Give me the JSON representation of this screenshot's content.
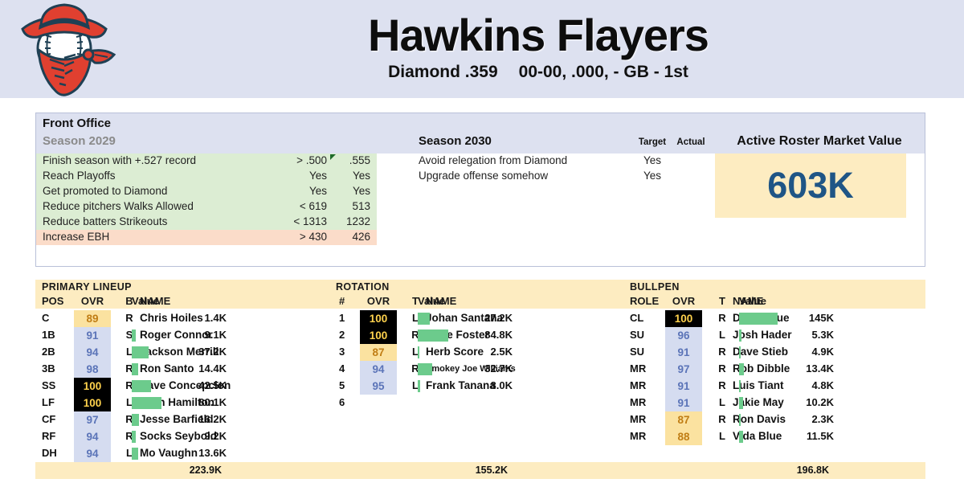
{
  "header": {
    "team_name": "Hawkins Flayers",
    "league": "Diamond .359",
    "record": "00-00, .000, - GB - 1st",
    "logo_name": "bandit-baseball-logo",
    "colors": {
      "banner_bg": "#dde1f0",
      "logo_red": "#e04030",
      "logo_navy": "#1f4054"
    }
  },
  "front_office": {
    "title": "Front Office",
    "left_season": "Season 2029",
    "right_season": "Season 2030",
    "th_target": "Target",
    "th_actual": "Actual",
    "market_value_title": "Active Roster Market Value",
    "market_value": "603K",
    "goals_2029": [
      {
        "label": "Finish season with +.527 record",
        "target": "> .500",
        "actual": ".555",
        "status": "ok",
        "flag": true
      },
      {
        "label": "Reach Playoffs",
        "target": "Yes",
        "actual": "Yes",
        "status": "ok",
        "flag": false
      },
      {
        "label": "Get promoted to Diamond",
        "target": "Yes",
        "actual": "Yes",
        "status": "ok",
        "flag": false
      },
      {
        "label": "Reduce pitchers Walks Allowed",
        "target": "< 619",
        "actual": "513",
        "status": "ok",
        "flag": false
      },
      {
        "label": "Reduce batters Strikeouts",
        "target": "< 1313",
        "actual": "1232",
        "status": "ok",
        "flag": false
      },
      {
        "label": "Increase EBH",
        "target": "> 430",
        "actual": "426",
        "status": "fail",
        "flag": false
      }
    ],
    "goals_2030": [
      {
        "label": "Avoid relegation from Diamond",
        "target": "Yes",
        "actual": ""
      },
      {
        "label": "Upgrade offense somehow",
        "target": "Yes",
        "actual": ""
      }
    ],
    "colors": {
      "ok_bg": "#dcedd3",
      "fail_bg": "#fbdcc9",
      "head_bg": "#dde1f0",
      "mv_bg": "#fdecc1",
      "mv_text": "#1f5586"
    }
  },
  "roster": {
    "band_color": "#fdecc1",
    "bar_color": "#6ccb8c",
    "lineup": {
      "section": "PRIMARY LINEUP",
      "headers": {
        "first": "POS",
        "ovr": "OVR",
        "hand": "B",
        "name": "NAME",
        "value": "Value"
      },
      "total": "223.9K",
      "rows": [
        {
          "first": "C",
          "ovr": "89",
          "tier": "gold",
          "hand": "R",
          "name": "Chris Hoiles",
          "value": "1.4K",
          "bar": 0
        },
        {
          "first": "1B",
          "ovr": "91",
          "tier": "lav",
          "hand": "S",
          "name": "Roger Connor",
          "value": "9.1K",
          "bar": 5
        },
        {
          "first": "2B",
          "ovr": "94",
          "tier": "lav",
          "hand": "L",
          "name": "Jackson Merrill",
          "value": "37.2K",
          "bar": 21
        },
        {
          "first": "3B",
          "ovr": "98",
          "tier": "lav",
          "hand": "R",
          "name": "Ron Santo",
          "value": "14.4K",
          "bar": 8
        },
        {
          "first": "SS",
          "ovr": "100",
          "tier": "black",
          "hand": "R",
          "name": "Dave Concepcion",
          "value": "42.5K",
          "bar": 24
        },
        {
          "first": "LF",
          "ovr": "100",
          "tier": "black",
          "hand": "L",
          "name": "Josh Hamilton",
          "value": "80.1K",
          "bar": 37
        },
        {
          "first": "CF",
          "ovr": "97",
          "tier": "lav",
          "hand": "R",
          "name": "Jesse Barfield",
          "value": "16.2K",
          "bar": 9
        },
        {
          "first": "RF",
          "ovr": "94",
          "tier": "lav",
          "hand": "R",
          "name": "Socks Seybold",
          "value": "9.2K",
          "bar": 5
        },
        {
          "first": "DH",
          "ovr": "94",
          "tier": "lav",
          "hand": "L",
          "name": "Mo Vaughn",
          "value": "13.6K",
          "bar": 8
        }
      ]
    },
    "rotation": {
      "section": "ROTATION",
      "headers": {
        "first": "#",
        "ovr": "OVR",
        "hand": "T",
        "name": "NAME",
        "value": "Value"
      },
      "total": "155.2K",
      "rows": [
        {
          "first": "1",
          "ovr": "100",
          "tier": "black",
          "hand": "L",
          "name": "Johan Santana",
          "value": "27.2K",
          "bar": 15,
          "small": false
        },
        {
          "first": "2",
          "ovr": "100",
          "tier": "black",
          "hand": "R",
          "name": "Rube Foster",
          "value": "84.8K",
          "bar": 38,
          "small": false
        },
        {
          "first": "3",
          "ovr": "87",
          "tier": "gold",
          "hand": "L",
          "name": "Herb Score",
          "value": "2.5K",
          "bar": 2,
          "small": false
        },
        {
          "first": "4",
          "ovr": "94",
          "tier": "lav",
          "hand": "R",
          "name": "Smokey Joe Williams",
          "value": "32.7K",
          "bar": 18,
          "small": true
        },
        {
          "first": "5",
          "ovr": "95",
          "tier": "lav",
          "hand": "L",
          "name": "Frank Tanana",
          "value": "8.0K",
          "bar": 3,
          "small": false
        },
        {
          "first": "6",
          "ovr": "",
          "tier": "none",
          "hand": "",
          "name": "",
          "value": "",
          "bar": 0,
          "small": false
        }
      ]
    },
    "bullpen": {
      "section": "BULLPEN",
      "headers": {
        "first": "ROLE",
        "ovr": "OVR",
        "hand": "T",
        "name": "NAME",
        "value": "Value"
      },
      "total": "196.8K",
      "rows": [
        {
          "first": "CL",
          "ovr": "100",
          "tier": "black",
          "hand": "R",
          "name": "Dolf Luque",
          "value": "145K",
          "bar": 48
        },
        {
          "first": "SU",
          "ovr": "96",
          "tier": "lav",
          "hand": "L",
          "name": "Josh Hader",
          "value": "5.3K",
          "bar": 3
        },
        {
          "first": "SU",
          "ovr": "91",
          "tier": "lav",
          "hand": "R",
          "name": "Dave Stieb",
          "value": "4.9K",
          "bar": 2
        },
        {
          "first": "MR",
          "ovr": "97",
          "tier": "lav",
          "hand": "R",
          "name": "Rob Dibble",
          "value": "13.4K",
          "bar": 6
        },
        {
          "first": "MR",
          "ovr": "91",
          "tier": "lav",
          "hand": "R",
          "name": "Luis Tiant",
          "value": "4.8K",
          "bar": 2
        },
        {
          "first": "MR",
          "ovr": "91",
          "tier": "lav",
          "hand": "L",
          "name": "Jakie May",
          "value": "10.2K",
          "bar": 5
        },
        {
          "first": "MR",
          "ovr": "87",
          "tier": "gold",
          "hand": "R",
          "name": "Ron Davis",
          "value": "2.3K",
          "bar": 2
        },
        {
          "first": "MR",
          "ovr": "88",
          "tier": "gold",
          "hand": "L",
          "name": "Vida Blue",
          "value": "11.5K",
          "bar": 5
        }
      ]
    }
  }
}
